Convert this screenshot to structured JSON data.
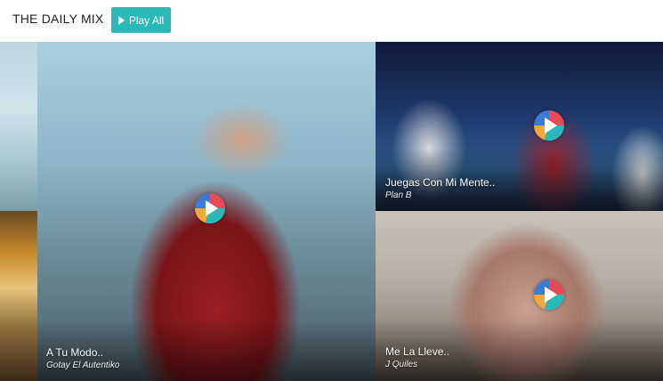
{
  "header": {
    "title": "THE DAILY MIX",
    "play_all_label": "Play All"
  },
  "tiles": [
    {
      "song": "A Tu Modo..",
      "artist": "Gotay El Autentiko"
    },
    {
      "song": "Juegas Con Mi Mente..",
      "artist": "Plan B"
    },
    {
      "song": "Me La Lleve..",
      "artist": "J Quiles"
    }
  ],
  "icons": {
    "play_all": "play-triangle-icon",
    "tile_play": "play-circle-icon"
  },
  "colors": {
    "accent": "#2bb8b8"
  }
}
